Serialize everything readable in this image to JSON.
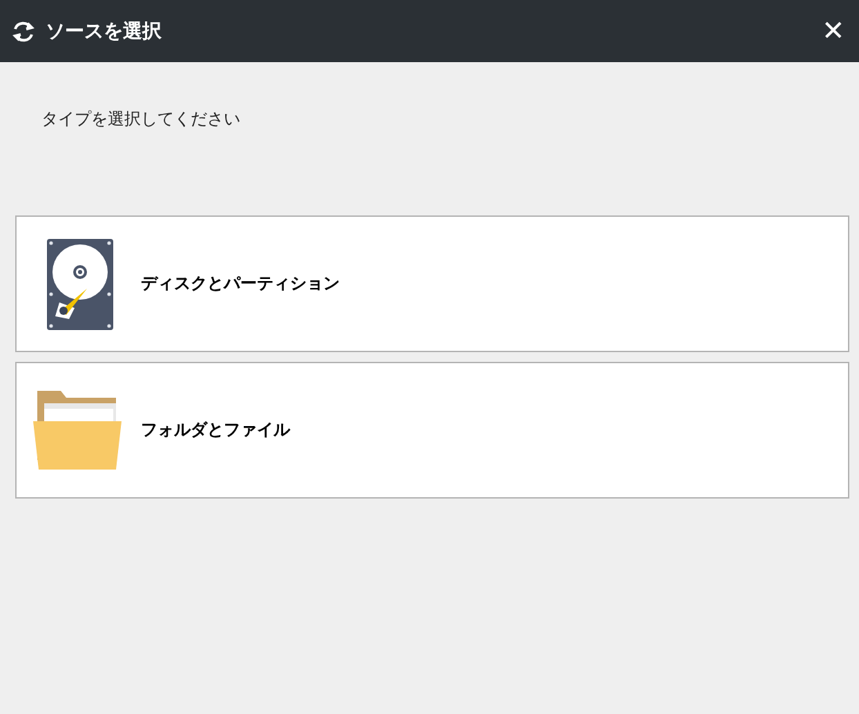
{
  "window": {
    "title": "ソースを選択",
    "close": "✕"
  },
  "prompt": "タイプを選択してください",
  "options": [
    {
      "kind": "disk",
      "label": "ディスクとパーティション"
    },
    {
      "kind": "folder",
      "label": "フォルダとファイル"
    }
  ]
}
